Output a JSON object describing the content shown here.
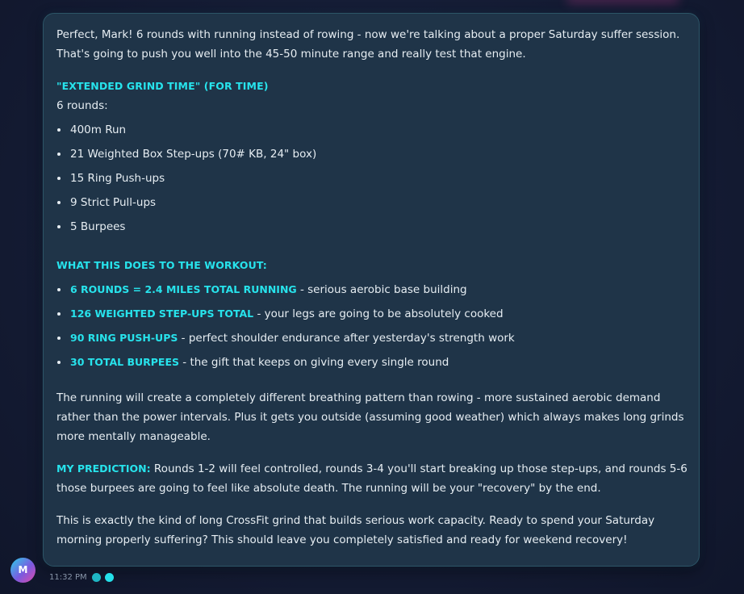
{
  "message": {
    "intro": "Perfect, Mark! 6 rounds with running instead of rowing - now we're talking about a proper Saturday suffer session. That's going to push you well into the 45-50 minute range and really test that engine.",
    "workout_title": "\"EXTENDED GRIND TIME\" (FOR TIME)",
    "rounds_label": "6 rounds:",
    "movements": [
      "400m Run",
      "21 Weighted Box Step-ups (70# KB, 24\" box)",
      "15 Ring Push-ups",
      "9 Strict Pull-ups",
      "5 Burpees"
    ],
    "effects_heading": "WHAT THIS DOES TO THE WORKOUT:",
    "effects": [
      {
        "highlight": "6 ROUNDS = 2.4 MILES TOTAL RUNNING",
        "text": " - serious aerobic base building"
      },
      {
        "highlight": "126 WEIGHTED STEP-UPS TOTAL",
        "text": " - your legs are going to be absolutely cooked"
      },
      {
        "highlight": "90 RING PUSH-UPS",
        "text": " - perfect shoulder endurance after yesterday's strength work"
      },
      {
        "highlight": "30 TOTAL BURPEES",
        "text": " - the gift that keeps on giving every single round"
      }
    ],
    "running_paragraph": "The running will create a completely different breathing pattern than rowing - more sustained aerobic demand rather than the power intervals. Plus it gets you outside (assuming good weather) which always makes long grinds more mentally manageable.",
    "prediction_label": "MY PREDICTION:",
    "prediction_text": " Rounds 1-2 will feel controlled, rounds 3-4 you'll start breaking up those step-ups, and rounds 5-6 those burpees are going to feel like absolute death. The running will be your \"recovery\" by the end.",
    "closing": "This is exactly the kind of long CrossFit grind that builds serious work capacity. Ready to spend your Saturday morning properly suffering? This should leave you completely satisfied and ready for weekend recovery!"
  },
  "footer": {
    "avatar_initial": "M",
    "timestamp": "11:32 PM"
  },
  "colors": {
    "accent": "#27e3ec",
    "bubble_bg": "#1f3448",
    "page_bg": "#131a30"
  },
  "icons": {
    "avatar": "avatar-circle",
    "status_dots": [
      "status-dot-icon",
      "status-dot-icon"
    ]
  }
}
